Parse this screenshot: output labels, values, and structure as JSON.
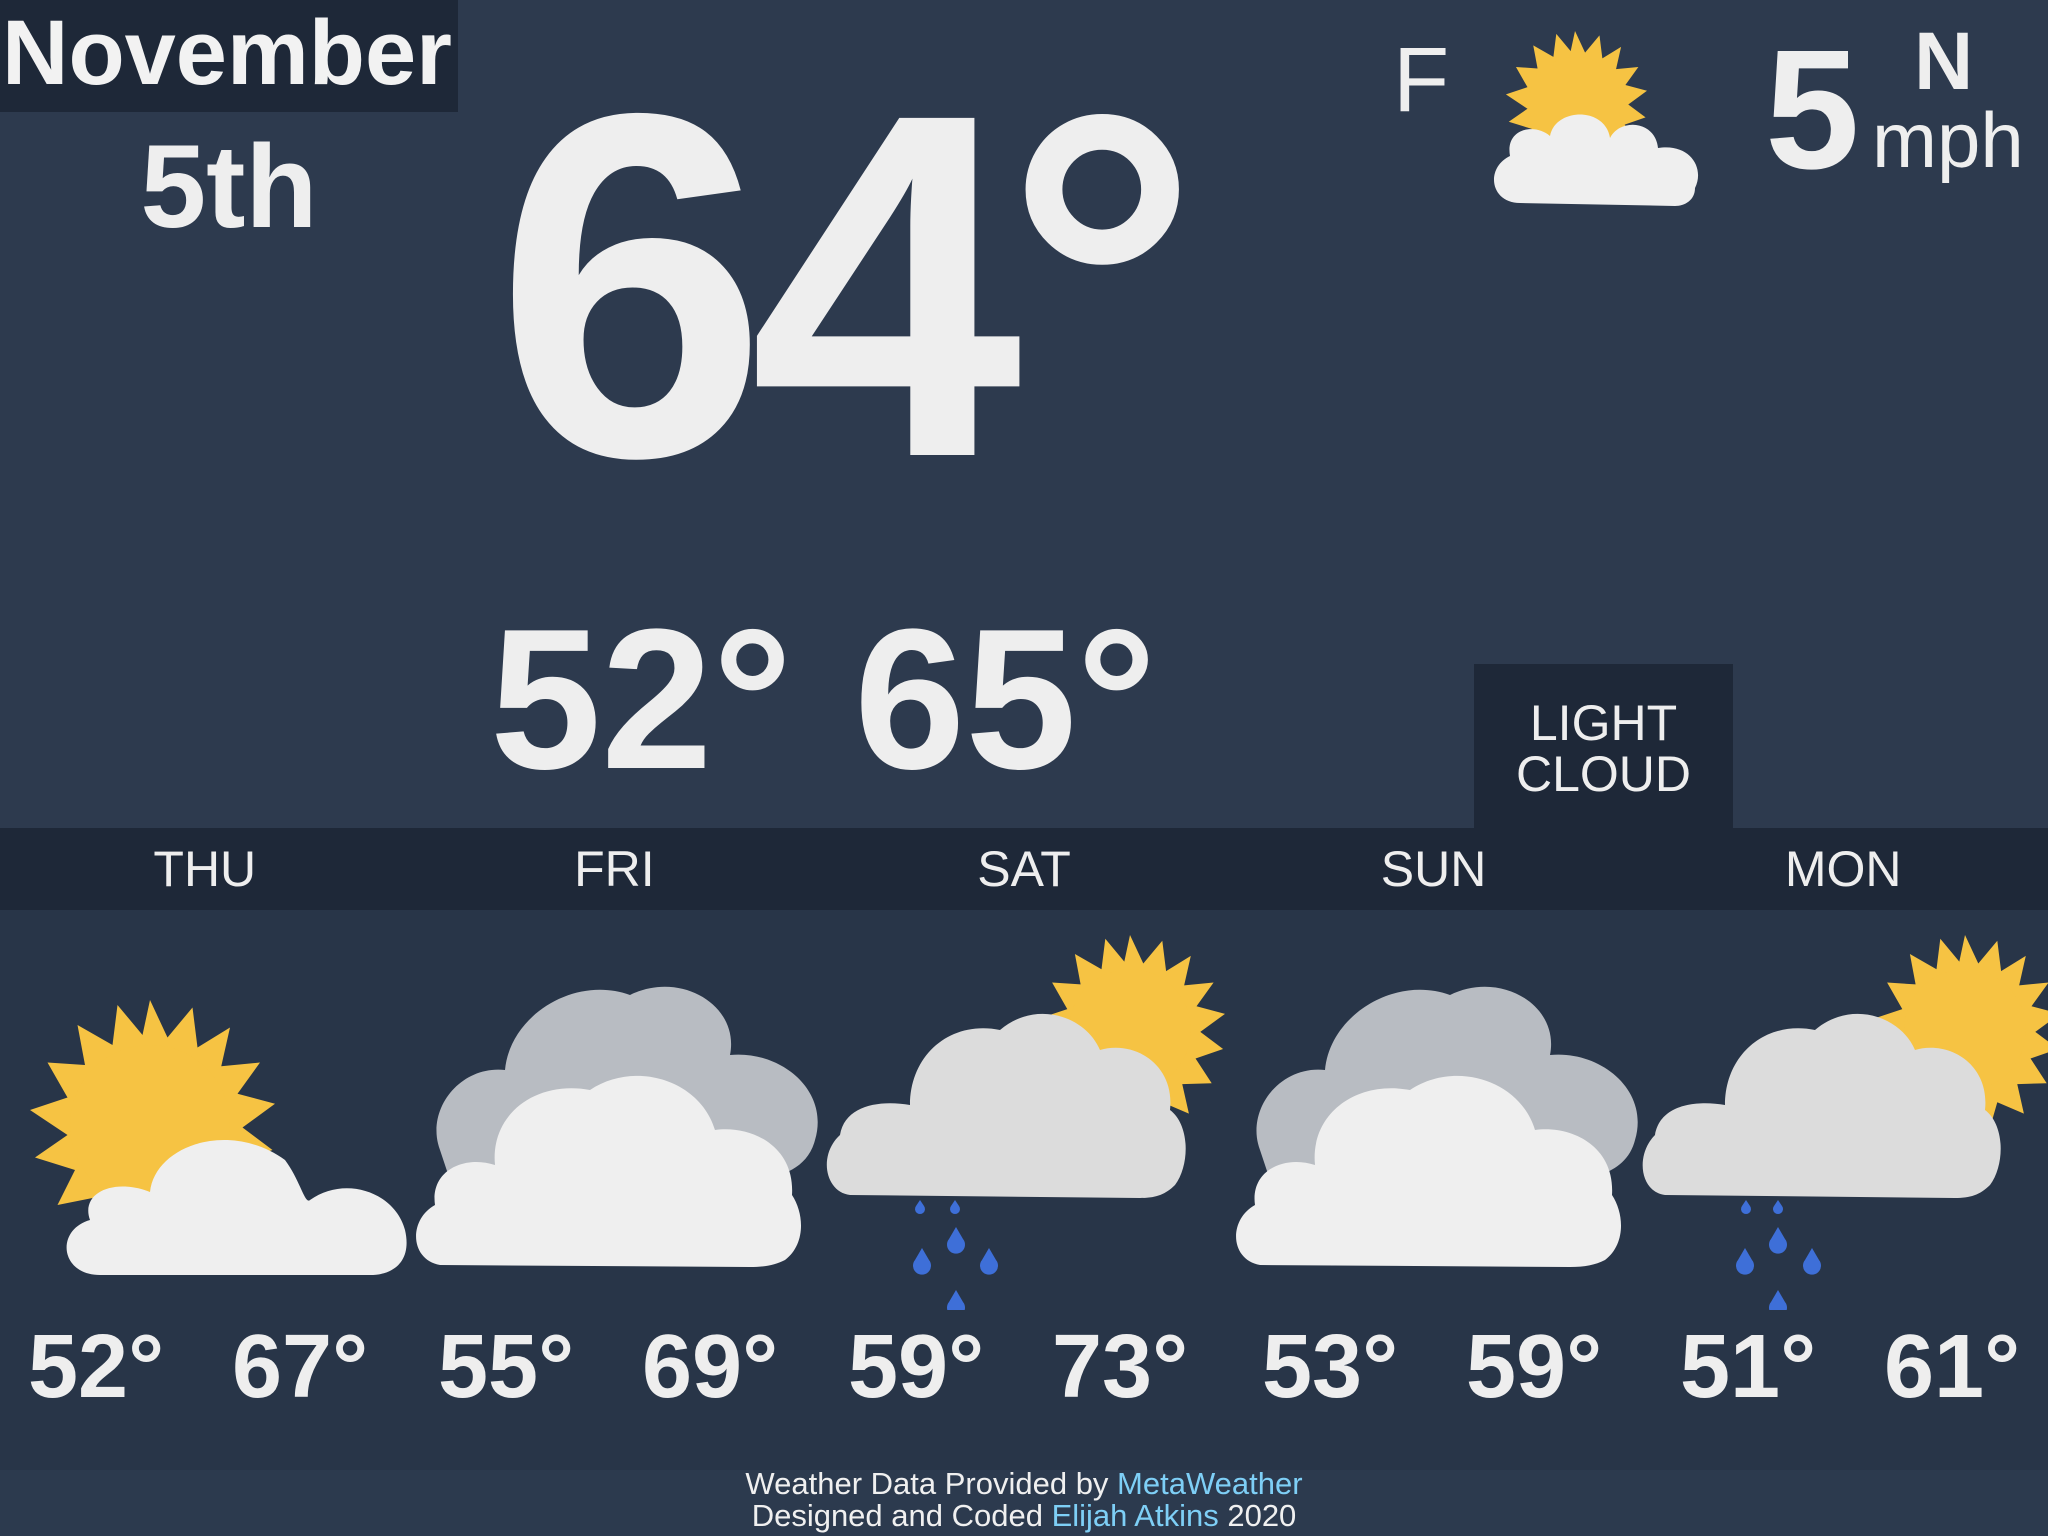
{
  "date": {
    "month": "November",
    "day": "5th"
  },
  "current": {
    "temp": "64°",
    "unit": "F",
    "icon": "partly-sunny-icon",
    "wind_speed": "5",
    "wind_direction": "N",
    "wind_unit": "mph",
    "low": "52°",
    "high": "65°",
    "description_line1": "LIGHT",
    "description_line2": "CLOUD"
  },
  "forecast": [
    {
      "day": "THU",
      "low": "52°",
      "high": "67°",
      "icon": "sun-behind-cloud-icon"
    },
    {
      "day": "FRI",
      "low": "55°",
      "high": "69°",
      "icon": "heavy-cloud-icon"
    },
    {
      "day": "SAT",
      "low": "59°",
      "high": "73°",
      "icon": "light-rain-sun-icon"
    },
    {
      "day": "SUN",
      "low": "53°",
      "high": "59°",
      "icon": "heavy-cloud-icon"
    },
    {
      "day": "MON",
      "low": "51°",
      "high": "61°",
      "icon": "light-rain-sun-icon"
    }
  ],
  "footer": {
    "line1_prefix": "Weather Data Provided by ",
    "line1_link": "MetaWeather",
    "line2_prefix": "Designed and Coded ",
    "line2_link": "Elijah Atkins",
    "line2_suffix": " 2020"
  },
  "colors": {
    "background": "#2d3a4e",
    "panel": "#1e2838",
    "sun": "#f6c343",
    "cloud_light": "#efefef",
    "cloud_dark": "#b8bcc2",
    "rain": "#3e6fd8",
    "link": "#7ecff6"
  }
}
